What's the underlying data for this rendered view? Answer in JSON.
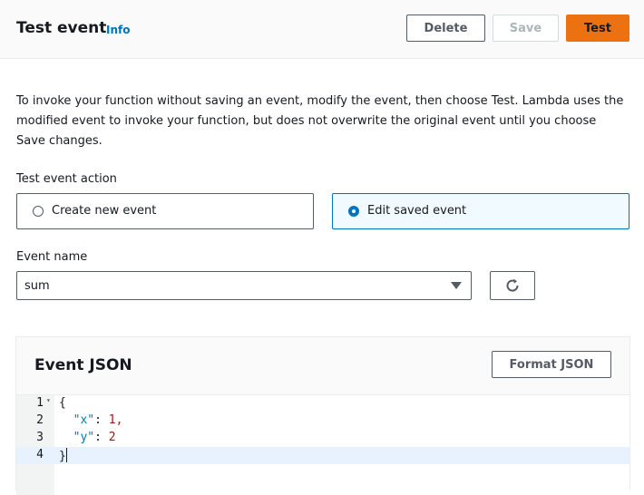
{
  "header": {
    "title": "Test event",
    "info_label": "Info",
    "delete_label": "Delete",
    "save_label": "Save",
    "test_label": "Test"
  },
  "description": "To invoke your function without saving an event, modify the event, then choose Test. Lambda uses the modified event to invoke your function, but does not overwrite the original event until you choose Save changes.",
  "test_event_action": {
    "label": "Test event action",
    "options": [
      {
        "label": "Create new event",
        "selected": false
      },
      {
        "label": "Edit saved event",
        "selected": true
      }
    ]
  },
  "event_name": {
    "label": "Event name",
    "value": "sum",
    "refresh_icon": "refresh-icon"
  },
  "event_json": {
    "title": "Event JSON",
    "format_label": "Format JSON",
    "lines": [
      {
        "num": "1",
        "text": "{"
      },
      {
        "num": "2",
        "key": "\"x\"",
        "value": "1,"
      },
      {
        "num": "3",
        "key": "\"y\"",
        "value": "2"
      },
      {
        "num": "4",
        "text": "}"
      }
    ]
  },
  "colors": {
    "primary": "#ec7211",
    "link": "#0073bb",
    "selected_bg": "#f1faff"
  }
}
